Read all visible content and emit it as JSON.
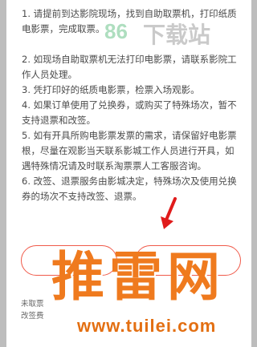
{
  "notes": [
    "1. 请提前到达影院现场，找到自助取票机，打印纸质电影票，完成取票。",
    "2. 如现场自助取票机无法打印电影票，请联系影院工作人员处理。",
    "3. 凭打印好的纸质电影票，检票入场观影。",
    "4. 如果订单使用了兑换券，或购买了特殊场次，暂不支持退票和改签。",
    "5. 如有开具所购电影票发票的需求，请保留好电影票根，尽量在观影当天联系影城工作人员进行开具，如遇特殊情况请及时联系淘票票人工客服咨询。",
    "6. 改签、退票服务由影城决定，特殊场次及使用兑换券的场次不支持改签、退票。"
  ],
  "buttons": {
    "left": "",
    "right": ""
  },
  "footer": {
    "line1": "未取票",
    "line2": "改签费"
  },
  "watermarks": {
    "top_logo": "86",
    "top_text": "下载站",
    "big_text": "推雷网",
    "url": "www.tuilei.com"
  },
  "colors": {
    "accent": "#f05a4a",
    "watermark": "#ef7a1e",
    "overlay": "#bdbdbd"
  }
}
